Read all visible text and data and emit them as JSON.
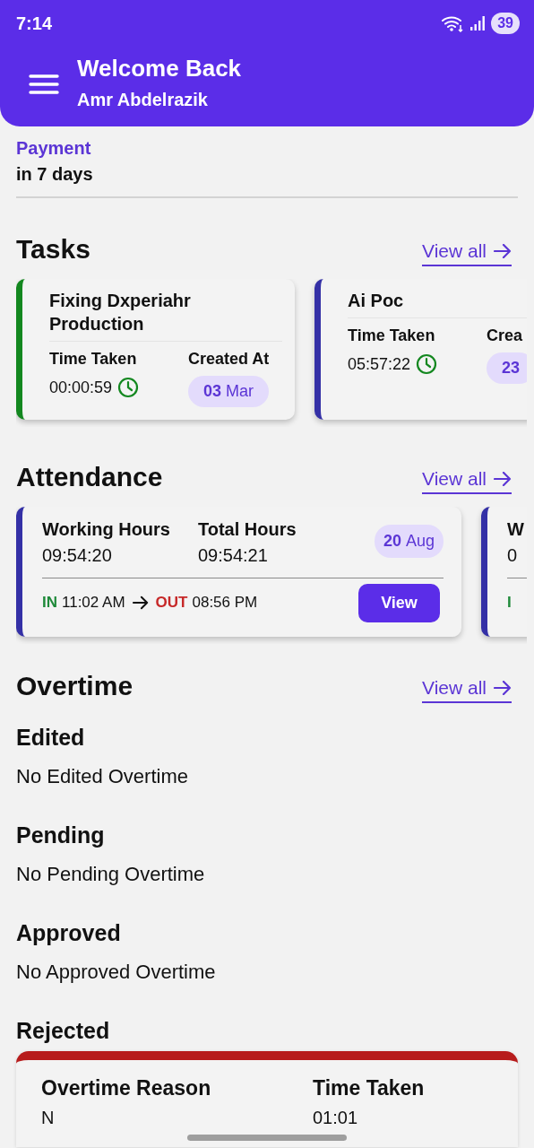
{
  "status_bar": {
    "time": "7:14",
    "battery": "39"
  },
  "header": {
    "title": "Welcome Back",
    "name": "Amr Abdelrazik"
  },
  "payment": {
    "label": "Payment",
    "value": "in 7 days"
  },
  "tasks": {
    "title": "Tasks",
    "view_all": "View all",
    "cards": [
      {
        "title": "Fixing Dxperiahr Production",
        "color": "#13871f",
        "time_label": "Time Taken",
        "time": "00:00:59",
        "created_label": "Created At",
        "day": "03",
        "month": "Mar"
      },
      {
        "title": "Ai Poc",
        "color": "#3430a6",
        "time_label": "Time Taken",
        "time": "05:57:22",
        "created_label": "Crea",
        "day": "23"
      }
    ]
  },
  "attendance": {
    "title": "Attendance",
    "view_all": "View all",
    "cards": [
      {
        "working_label": "Working Hours",
        "working": "09:54:20",
        "total_label": "Total Hours",
        "total": "09:54:21",
        "day": "20",
        "month": "Aug",
        "in_label": "IN",
        "in_time": "11:02 AM",
        "out_label": "OUT",
        "out_time": "08:56 PM",
        "button": "View"
      },
      {
        "working_label": "W",
        "working": "0",
        "in_label": "I"
      }
    ]
  },
  "overtime": {
    "title": "Overtime",
    "view_all": "View all",
    "groups": [
      {
        "title": "Edited",
        "text": "No Edited Overtime"
      },
      {
        "title": "Pending",
        "text": "No Pending Overtime"
      },
      {
        "title": "Approved",
        "text": "No Approved Overtime"
      },
      {
        "title": "Rejected",
        "items": [
          {
            "reason_label": "Overtime Reason",
            "reason": "N",
            "time_label": "Time Taken",
            "time": "01:01"
          }
        ]
      }
    ]
  }
}
